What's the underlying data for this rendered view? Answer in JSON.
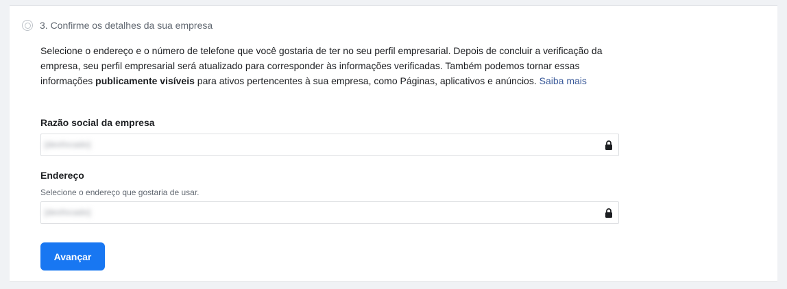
{
  "step": {
    "title": "3. Confirme os detalhes da sua empresa"
  },
  "description": {
    "part1": "Selecione o endereço e o número de telefone que você gostaria de ter no seu perfil empresarial. Depois de concluir a verificação da empresa, seu perfil empresarial será atualizado para corresponder às informações verificadas. Também podemos tornar essas informações ",
    "bold": "publicamente visíveis",
    "part2": " para ativos pertencentes à sua empresa, como Páginas, aplicativos e anúncios. ",
    "link": "Saiba mais"
  },
  "company_name": {
    "label": "Razão social da empresa",
    "value": "[desfocado]",
    "icon": "lock-icon"
  },
  "address": {
    "label": "Endereço",
    "help": "Selecione o endereço que gostaria de usar.",
    "value": "[desfocado]",
    "icon": "lock-icon"
  },
  "actions": {
    "next_label": "Avançar"
  },
  "colors": {
    "primary": "#1877f2",
    "link": "#385898",
    "background": "#f0f2f5"
  }
}
